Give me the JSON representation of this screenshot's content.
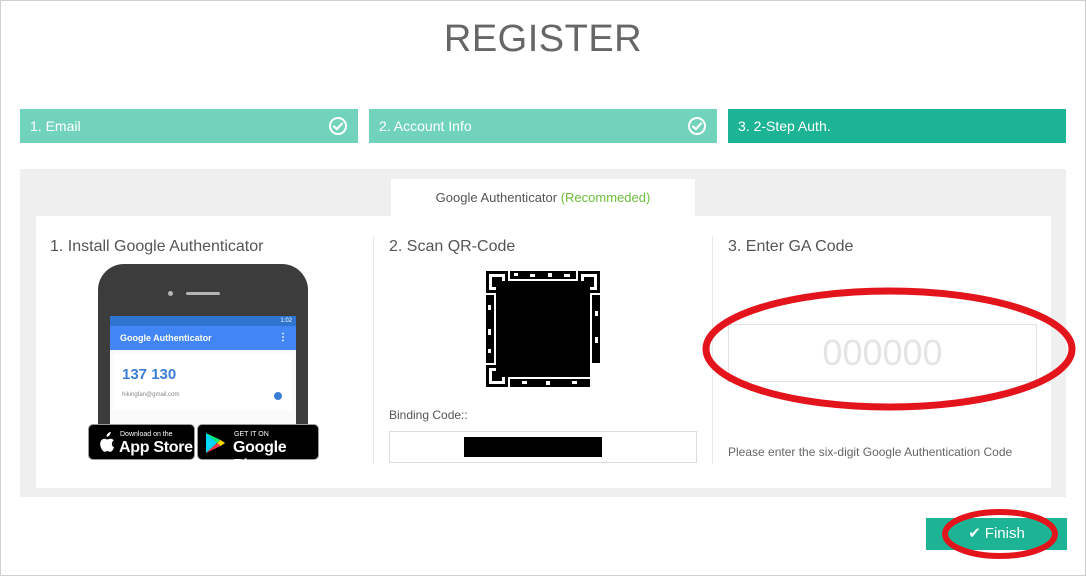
{
  "page": {
    "title": "REGISTER"
  },
  "steps": [
    {
      "label": "1. Email",
      "status": "done"
    },
    {
      "label": "2. Account Info",
      "status": "done"
    },
    {
      "label": "3. 2-Step Auth.",
      "status": "active"
    }
  ],
  "tab": {
    "label": "Google Authenticator",
    "badge": "(Recommeded)"
  },
  "install": {
    "title": "1. Install Google Authenticator",
    "phone": {
      "status_time": "1:02",
      "app_title": "Google Authenticator",
      "code": "137 130",
      "account": "hikingfan@gmail.com"
    },
    "app_store": {
      "small": "Download on the",
      "big": "App Store"
    },
    "google_play": {
      "small": "GET IT ON",
      "big": "Google Play"
    }
  },
  "scan": {
    "title": "2. Scan QR-Code",
    "binding_label": "Binding Code::"
  },
  "enter": {
    "title": "3. Enter GA Code",
    "placeholder": "000000",
    "hint": "Please enter the six-digit Google Authentication Code"
  },
  "finish_button": {
    "label": "Finish"
  },
  "colors": {
    "step_done": "#72d3bd",
    "step_active": "#1db395",
    "annotation": "#e3141b",
    "recommended": "#6cbf3b"
  }
}
